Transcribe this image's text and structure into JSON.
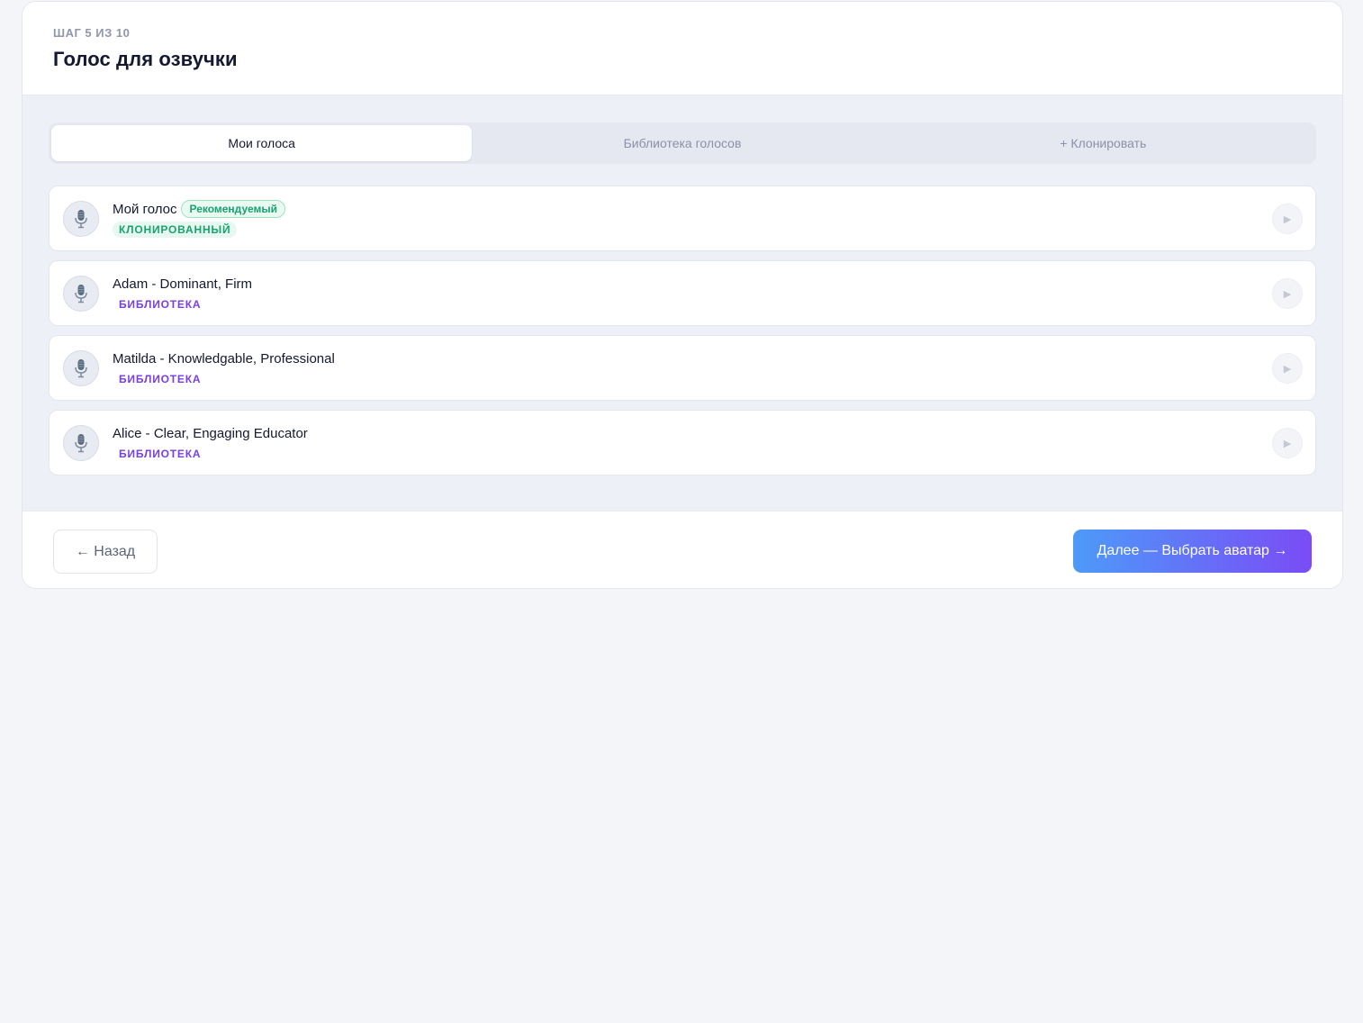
{
  "header": {
    "step_label": "ШАГ 5 ИЗ 10",
    "title": "Голос для озвучки"
  },
  "tabs": [
    {
      "label": "Мои голоса",
      "active": true
    },
    {
      "label": "Библиотека голосов",
      "active": false
    },
    {
      "label": "+ Клонировать",
      "active": false
    }
  ],
  "voices": [
    {
      "name": "Мой голос",
      "badge": "Рекомендуемый",
      "type": "КЛОНИРОВАННЫЙ",
      "icon": "microphone-icon"
    },
    {
      "name": "Adam - Dominant, Firm",
      "type": "БИБЛИОТЕКА",
      "icon": "microphone-icon"
    },
    {
      "name": "Matilda - Knowledgable, Professional",
      "type": "БИБЛИОТЕКА",
      "icon": "microphone-icon"
    },
    {
      "name": "Alice - Clear, Engaging Educator",
      "type": "БИБЛИОТЕКА",
      "icon": "microphone-icon"
    }
  ],
  "play_icon": "▶",
  "footer": {
    "back_label": "← Назад",
    "next_label": "Далее — Выбрать аватар →"
  },
  "colors": {
    "accent_start": "#4d9af8",
    "accent_end": "#7a4cf6",
    "cloned_green": "#17a36f",
    "library_purple": "#7a3fe4"
  }
}
